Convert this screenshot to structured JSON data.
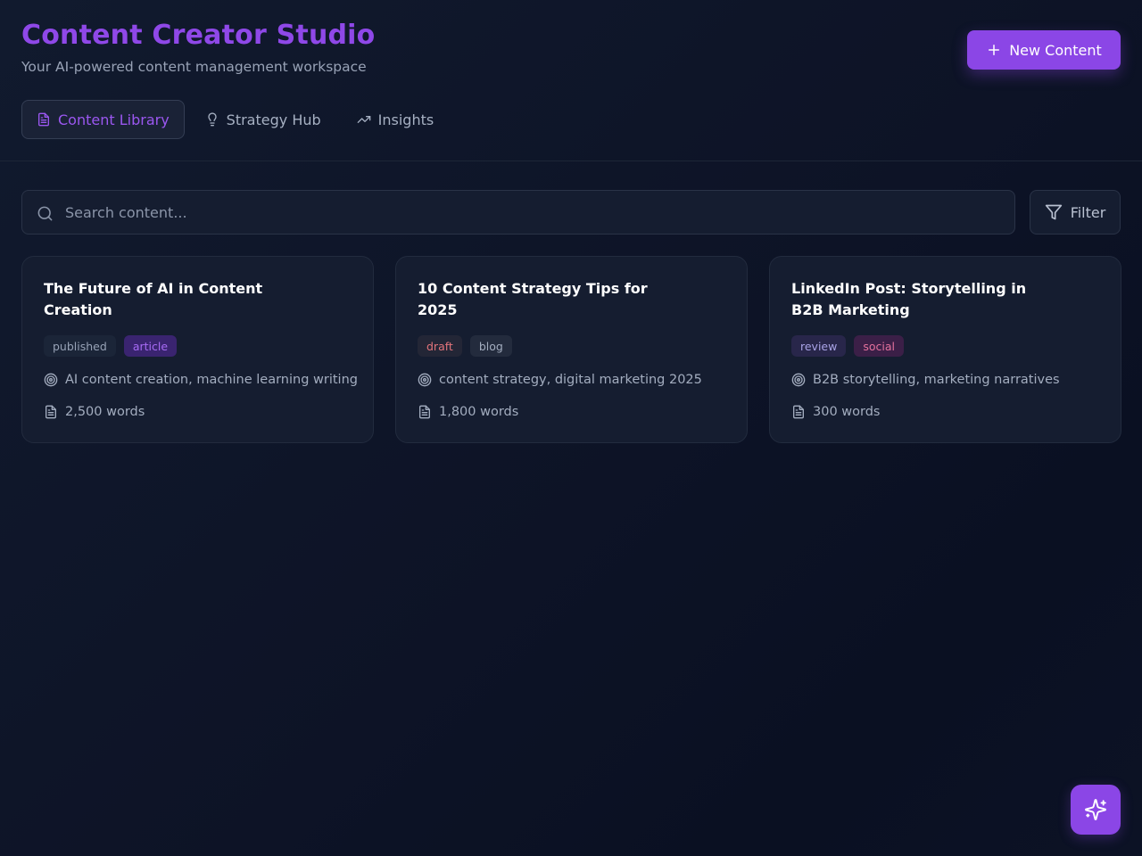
{
  "app": {
    "title": "Content Creator Studio",
    "subtitle": "Your AI-powered content management workspace",
    "accent": "#8b46e6"
  },
  "header": {
    "new_button": {
      "label": "New Content",
      "icon": "plus-icon"
    }
  },
  "tabs": [
    {
      "label": "Content Library",
      "icon": "document-icon",
      "active": true
    },
    {
      "label": "Strategy Hub",
      "icon": "lightbulb-icon",
      "active": false
    },
    {
      "label": "Insights",
      "icon": "trending-up-icon",
      "active": false
    }
  ],
  "search": {
    "placeholder": "Search content...",
    "value": "",
    "icon": "search-icon"
  },
  "filter": {
    "label": "Filter",
    "icon": "filter-icon"
  },
  "cards": [
    {
      "title": "The Future of AI in Content Creation",
      "status": {
        "label": "published",
        "bg": "#1b2538",
        "fg": "#97a2b6"
      },
      "type": {
        "label": "article",
        "bg": "#3a2470",
        "fg": "#a76bf4"
      },
      "keywords": "AI content creation, machine learning writing",
      "words": "2,500 words"
    },
    {
      "title": "10 Content Strategy Tips for 2025",
      "status": {
        "label": "draft",
        "bg": "#232636",
        "fg": "#e3747b"
      },
      "type": {
        "label": "blog",
        "bg": "#232b3d",
        "fg": "#a3adbf"
      },
      "keywords": "content strategy, digital marketing 2025",
      "words": "1,800 words"
    },
    {
      "title": "LinkedIn Post: Storytelling in B2B Marketing",
      "status": {
        "label": "review",
        "bg": "#28264a",
        "fg": "#a9a3e6"
      },
      "type": {
        "label": "social",
        "bg": "#3b1f47",
        "fg": "#e4719d"
      },
      "keywords": "B2B storytelling, marketing narratives",
      "words": "300 words"
    }
  ],
  "fab": {
    "icon": "sparkles-icon"
  }
}
